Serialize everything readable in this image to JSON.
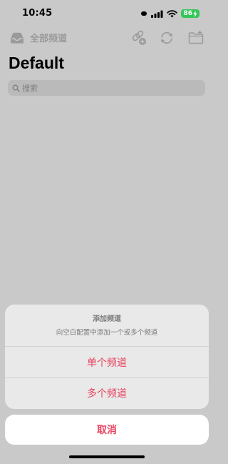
{
  "status_bar": {
    "time": "10:45",
    "battery": "86"
  },
  "nav": {
    "back_label": "全部频道",
    "icons": [
      "inbox-tray-icon",
      "link-add-icon",
      "refresh-icon",
      "folder-add-icon"
    ]
  },
  "page": {
    "title": "Default"
  },
  "search": {
    "placeholder": "搜索"
  },
  "action_sheet": {
    "title": "添加频道",
    "message": "向空白配置中添加一个或多个频道",
    "options": [
      "单个频道",
      "多个频道"
    ],
    "cancel": "取消"
  },
  "colors": {
    "accent": "#e8435f",
    "overlay_background": "#c9c9c9",
    "battery": "#33c759"
  }
}
